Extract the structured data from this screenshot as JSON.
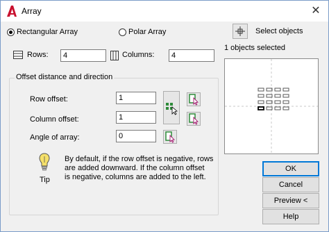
{
  "window": {
    "title": "Array"
  },
  "array_type": {
    "rectangular_label": "Rectangular Array",
    "polar_label": "Polar Array",
    "selected": "rectangular"
  },
  "select_objects": {
    "label": "Select objects",
    "status": "1 objects selected"
  },
  "rows": {
    "label": "Rows:",
    "value": "4"
  },
  "columns": {
    "label": "Columns:",
    "value": "4"
  },
  "offset": {
    "group_title": "Offset distance and direction",
    "row_offset_label": "Row offset:",
    "row_offset_value": "1",
    "column_offset_label": "Column offset:",
    "column_offset_value": "1",
    "angle_label": "Angle of array:",
    "angle_value": "0"
  },
  "tip": {
    "caption": "Tip",
    "text_line1": "By default, if the row offset is negative, rows",
    "text_line2": "are added downward.  If the column offset",
    "text_line3": "is negative, columns are added to the left."
  },
  "buttons": {
    "ok": "OK",
    "cancel": "Cancel",
    "preview": "Preview <",
    "help": "Help"
  },
  "colors": {
    "accent": "#0078d7",
    "app_red": "#c8102e"
  }
}
